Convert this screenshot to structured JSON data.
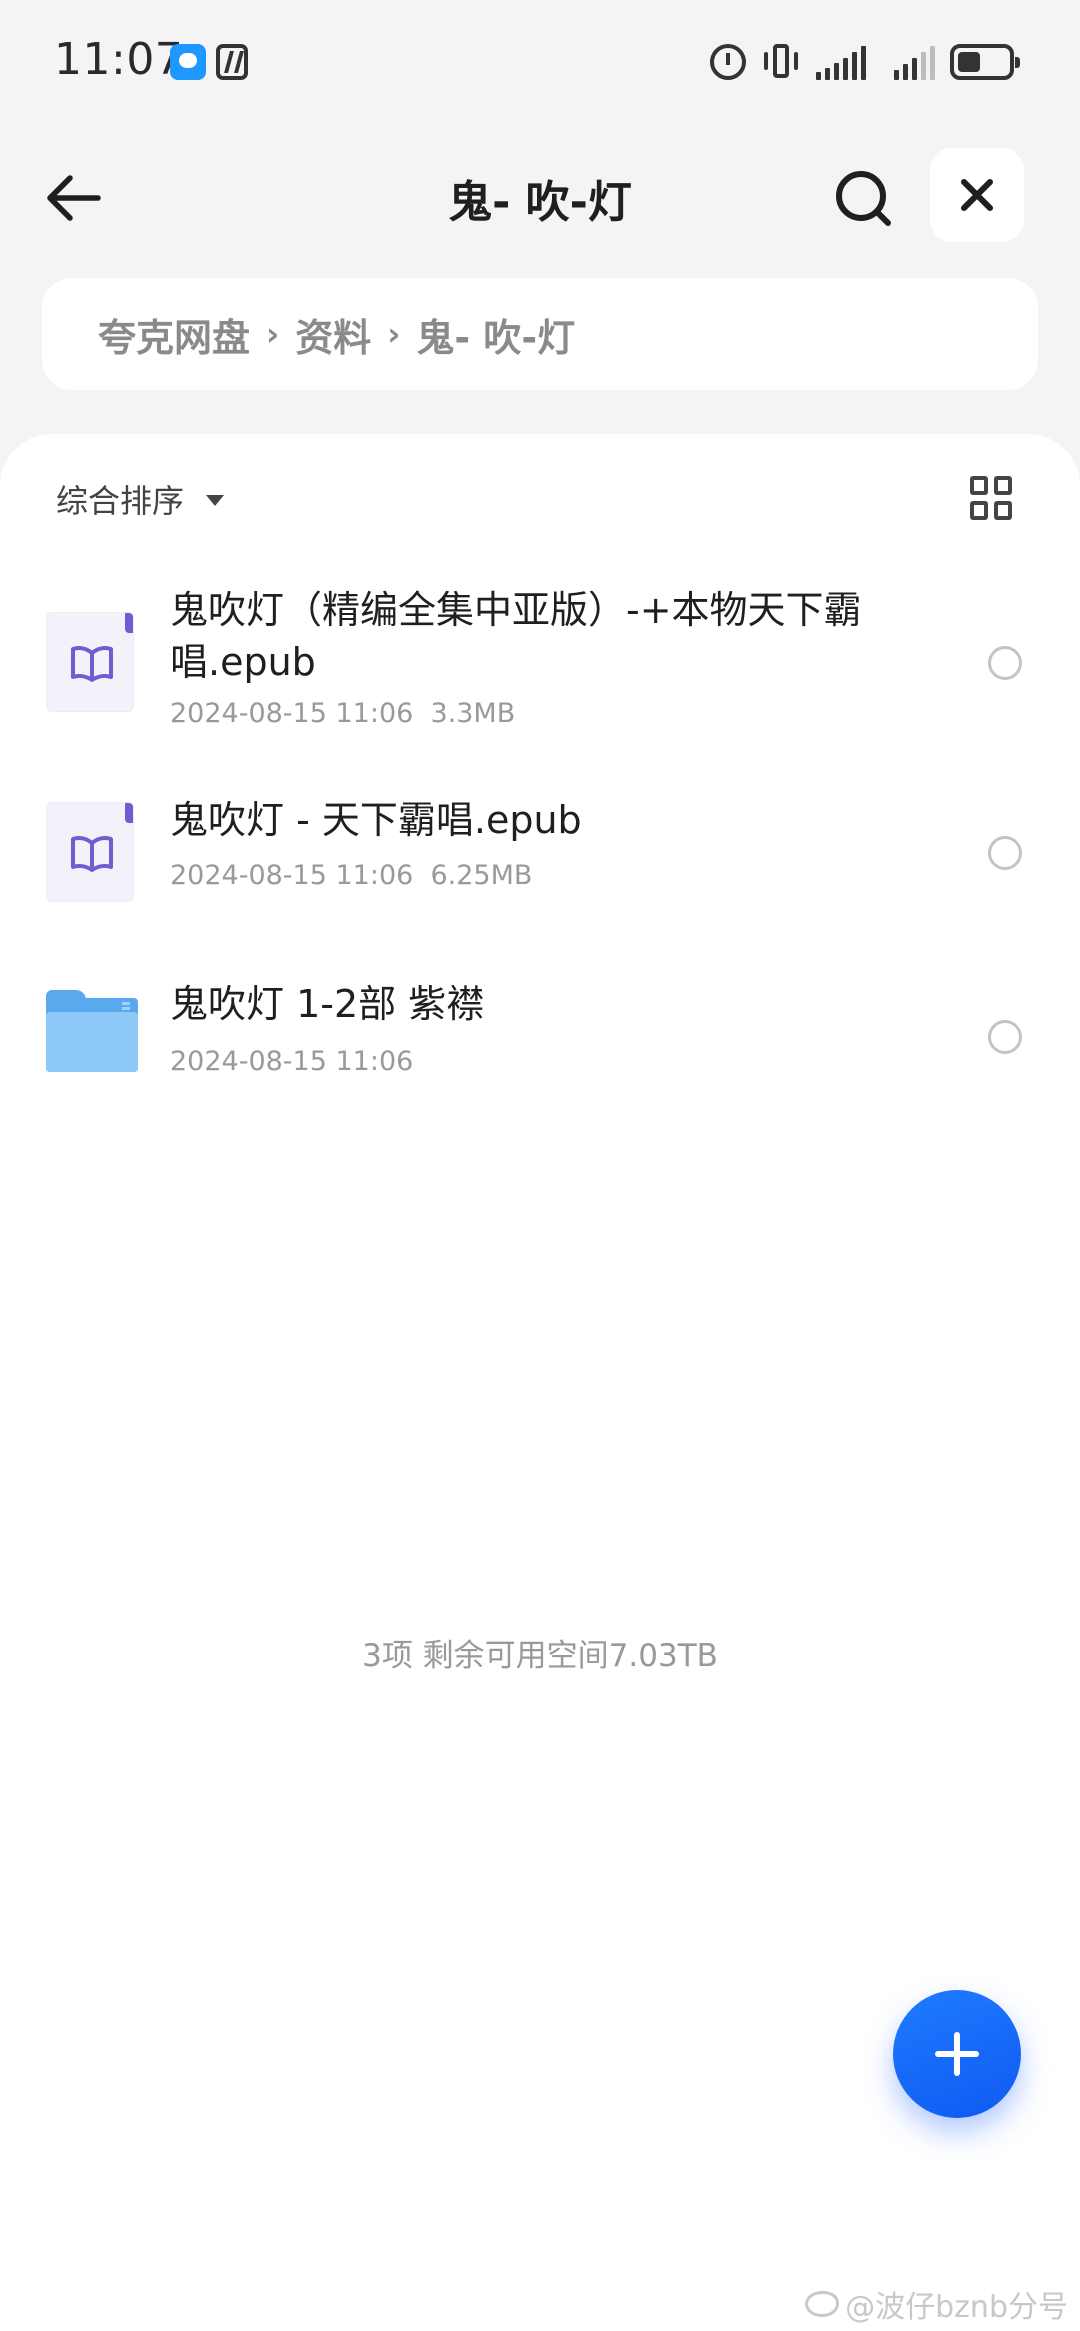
{
  "status_bar": {
    "time": "11:07"
  },
  "header": {
    "title": "鬼- 吹-灯"
  },
  "breadcrumb": [
    {
      "label": "夸克网盘"
    },
    {
      "label": "资料"
    },
    {
      "label": "鬼- 吹-灯"
    }
  ],
  "toolbar": {
    "sort_label": "综合排序"
  },
  "files": [
    {
      "name": "鬼吹灯（精编全集中亚版）-+本物天下霸唱.epub",
      "date": "2024-08-15 11:06",
      "size": "3.3MB",
      "type": "epub"
    },
    {
      "name": "鬼吹灯 - 天下霸唱.epub",
      "date": "2024-08-15 11:06",
      "size": "6.25MB",
      "type": "epub"
    },
    {
      "name": "鬼吹灯 1-2部 紫襟",
      "date": "2024-08-15 11:06",
      "size": "",
      "type": "folder"
    }
  ],
  "summary": "3项 剩余可用空间7.03TB",
  "watermark": "@波仔bznb分号",
  "colors": {
    "accent": "#1f6bff",
    "epub_accent": "#6b5fd1",
    "folder": "#5aa9ef"
  }
}
